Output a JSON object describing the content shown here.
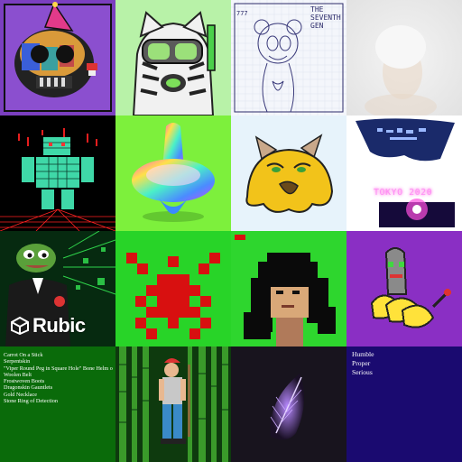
{
  "gallery": {
    "tiles": [
      {
        "label": "skull-party-hat"
      },
      {
        "label": "tiger-snorkel"
      },
      {
        "label": "seventh-gen-sketch"
      },
      {
        "label": "faded-portrait"
      },
      {
        "label": "voxel-robot"
      },
      {
        "label": "rainbow-spinning-top"
      },
      {
        "label": "gold-cat-blob"
      },
      {
        "label": "tokyo-night"
      },
      {
        "label": "pepe-rubic"
      },
      {
        "label": "pixel-invader"
      },
      {
        "label": "pixel-long-hair"
      },
      {
        "label": "banana-bot"
      },
      {
        "label": "loot-bag"
      },
      {
        "label": "bamboo-warrior"
      },
      {
        "label": "purple-feather"
      },
      {
        "label": "words"
      }
    ]
  },
  "seventh_gen": {
    "number": "777",
    "title_lines": [
      "THE",
      "SEVENTH",
      "GEN"
    ]
  },
  "tokyo": {
    "caption": "TOKYO 2020"
  },
  "rubic": {
    "brand": "Rubic"
  },
  "loot": {
    "items": [
      "Carrot On a Stick",
      "Serpentskin",
      "\"Viper Round Peg in Square Hole\" Bone Helm o",
      "Woolen Belt",
      "Frostwoven Boots",
      "Dragonskin Gauntlets",
      "Gold Necklace",
      "Stone Ring of Detection"
    ]
  },
  "words": {
    "lines": [
      "Humble",
      "Proper",
      "Serious"
    ]
  },
  "colors": {
    "tile1_bg": "#7b3fbf",
    "tile2_bg": "#b8f2a8",
    "tile6_bg": "#7df03c",
    "tile10_bg": "#28d428",
    "tile11_bg": "#2ed62e",
    "tile12_bg": "#8a2fc4",
    "tile13_bg": "#0a6b0a",
    "tile16_bg": "#1a0a70",
    "invader": "#d81010"
  }
}
